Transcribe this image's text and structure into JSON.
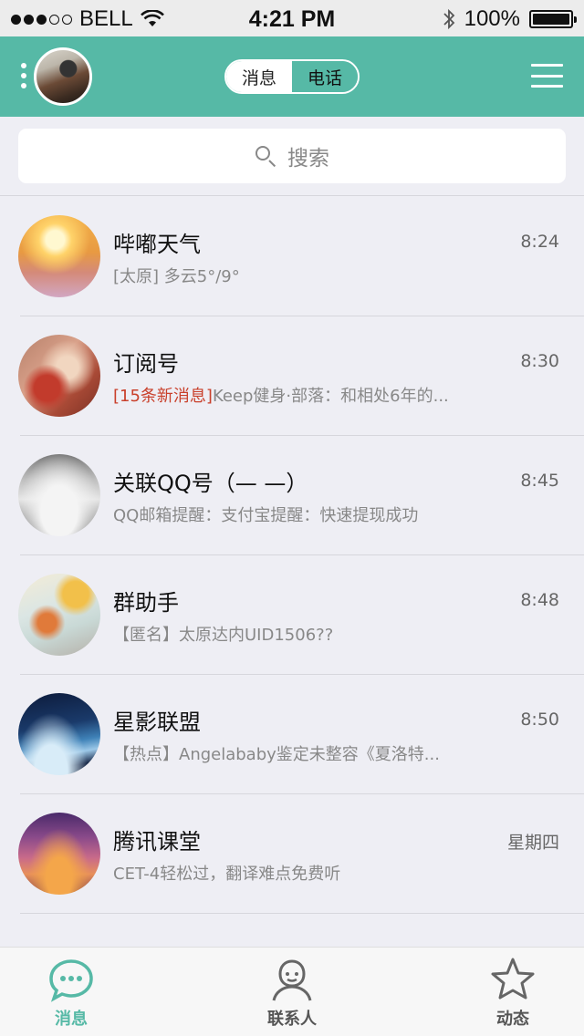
{
  "status_bar": {
    "carrier": "BELL",
    "time": "4:21 PM",
    "battery": "100%",
    "battery_level": 1.0,
    "signal_dots_filled": 3,
    "signal_dots_total": 5
  },
  "nav": {
    "segments": [
      "消息",
      "电话"
    ],
    "active_segment": "消息"
  },
  "search": {
    "placeholder": "搜索"
  },
  "chats": [
    {
      "name": "哔嘟天气",
      "time": "8:24",
      "highlight": "",
      "preview": "  [太原] 多云5°/9°"
    },
    {
      "name": "订阅号",
      "time": "8:30",
      "highlight": "[15条新消息]",
      "preview": "Keep健身·部落：和相处6年的..."
    },
    {
      "name": "关联QQ号（— —）",
      "time": "8:45",
      "highlight": "",
      "preview": "QQ邮箱提醒：支付宝提醒：快速提现成功"
    },
    {
      "name": "群助手",
      "time": "8:48",
      "highlight": "",
      "preview": "【匿名】太原达内UID1506??"
    },
    {
      "name": "星影联盟",
      "time": "8:50",
      "highlight": "",
      "preview": "【热点】Angelababy鉴定未整容《夏洛特..."
    },
    {
      "name": "腾讯课堂",
      "time": "星期四",
      "highlight": "",
      "preview": "CET-4轻松过，翻译难点免费听"
    }
  ],
  "tabs": [
    {
      "label": "消息",
      "icon": "chat-bubble-icon",
      "active": true
    },
    {
      "label": "联系人",
      "icon": "contact-person-icon",
      "active": false
    },
    {
      "label": "动态",
      "icon": "star-icon",
      "active": false
    }
  ],
  "colors": {
    "accent": "#56b9a6",
    "highlight": "#c9402b",
    "background": "#eeeef4"
  }
}
